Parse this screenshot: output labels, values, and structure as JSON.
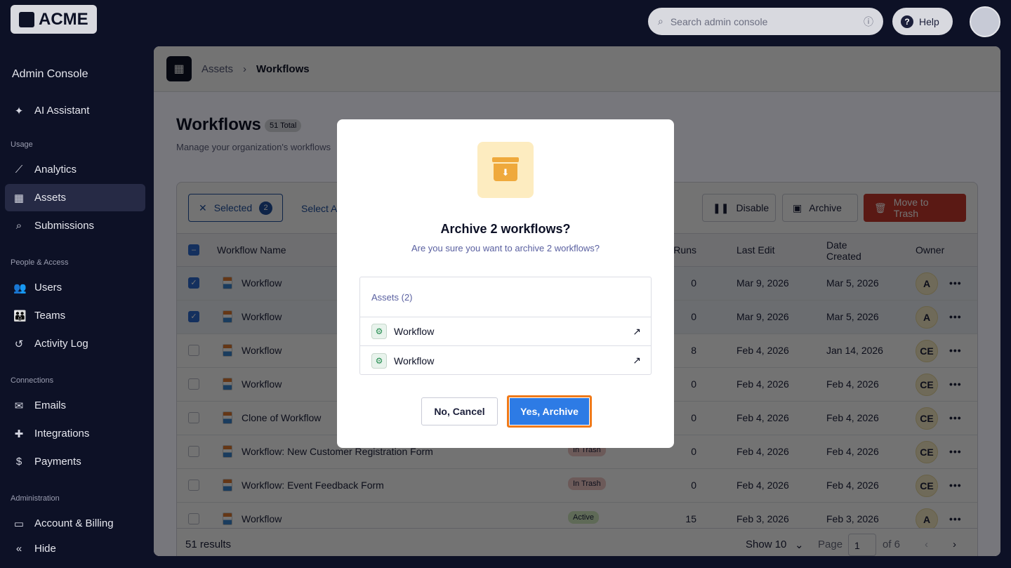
{
  "topbar": {
    "logo": "ACME",
    "search_placeholder": "Search admin console",
    "help": "Help"
  },
  "sidebar": {
    "title": "Admin Console",
    "ai": "AI Assistant",
    "sections": [
      "Usage",
      "People & Access",
      "Connections",
      "Administration"
    ],
    "items": [
      "Analytics",
      "Assets",
      "Submissions",
      "Users",
      "Teams",
      "Activity Log",
      "Emails",
      "Integrations",
      "Payments",
      "Account & Billing"
    ],
    "hide": "Hide"
  },
  "breadcrumb": {
    "parent": "Assets",
    "current": "Workflows"
  },
  "page": {
    "title": "Workflows",
    "total": "51 Total",
    "subtitle": "Manage your organization's workflows"
  },
  "toolbar": {
    "selected": "Selected",
    "selected_count": "2",
    "select_all": "Select All",
    "disable": "Disable",
    "archive": "Archive",
    "trash": "Move to Trash"
  },
  "columns": {
    "name": "Workflow Name",
    "runs": "Workflow Runs",
    "last_edit": "Last Edit",
    "created": "Date Created",
    "owner": "Owner"
  },
  "rows": [
    {
      "name": "Workflow",
      "status": "",
      "runs": "0",
      "edit": "Mar 9, 2026",
      "created": "Mar 5, 2026",
      "owner": "A",
      "checked": true
    },
    {
      "name": "Workflow",
      "status": "",
      "runs": "0",
      "edit": "Mar 9, 2026",
      "created": "Mar 5, 2026",
      "owner": "A",
      "checked": true
    },
    {
      "name": "Workflow",
      "status": "",
      "runs": "8",
      "edit": "Feb 4, 2026",
      "created": "Jan 14, 2026",
      "owner": "CE",
      "checked": false
    },
    {
      "name": "Workflow",
      "status": "",
      "runs": "0",
      "edit": "Feb 4, 2026",
      "created": "Feb 4, 2026",
      "owner": "CE",
      "checked": false
    },
    {
      "name": "Clone of Workflow",
      "status": "",
      "runs": "0",
      "edit": "Feb 4, 2026",
      "created": "Feb 4, 2026",
      "owner": "CE",
      "checked": false
    },
    {
      "name": "Workflow: New Customer Registration Form",
      "status": "In Trash",
      "runs": "0",
      "edit": "Feb 4, 2026",
      "created": "Feb 4, 2026",
      "owner": "CE",
      "checked": false
    },
    {
      "name": "Workflow: Event Feedback Form",
      "status": "In Trash",
      "runs": "0",
      "edit": "Feb 4, 2026",
      "created": "Feb 4, 2026",
      "owner": "CE",
      "checked": false
    },
    {
      "name": "Workflow",
      "status": "Active",
      "runs": "15",
      "edit": "Feb 3, 2026",
      "created": "Feb 3, 2026",
      "owner": "A",
      "checked": false
    }
  ],
  "footer": {
    "results": "51 results",
    "show": "Show 10",
    "page_label": "Page",
    "page": "1",
    "of": "of 6"
  },
  "modal": {
    "title": "Archive 2 workflows?",
    "message": "Are you sure you want to archive 2 workflows?",
    "assets_header": "Assets (2)",
    "assets": [
      "Workflow",
      "Workflow"
    ],
    "cancel": "No, Cancel",
    "confirm": "Yes, Archive"
  }
}
